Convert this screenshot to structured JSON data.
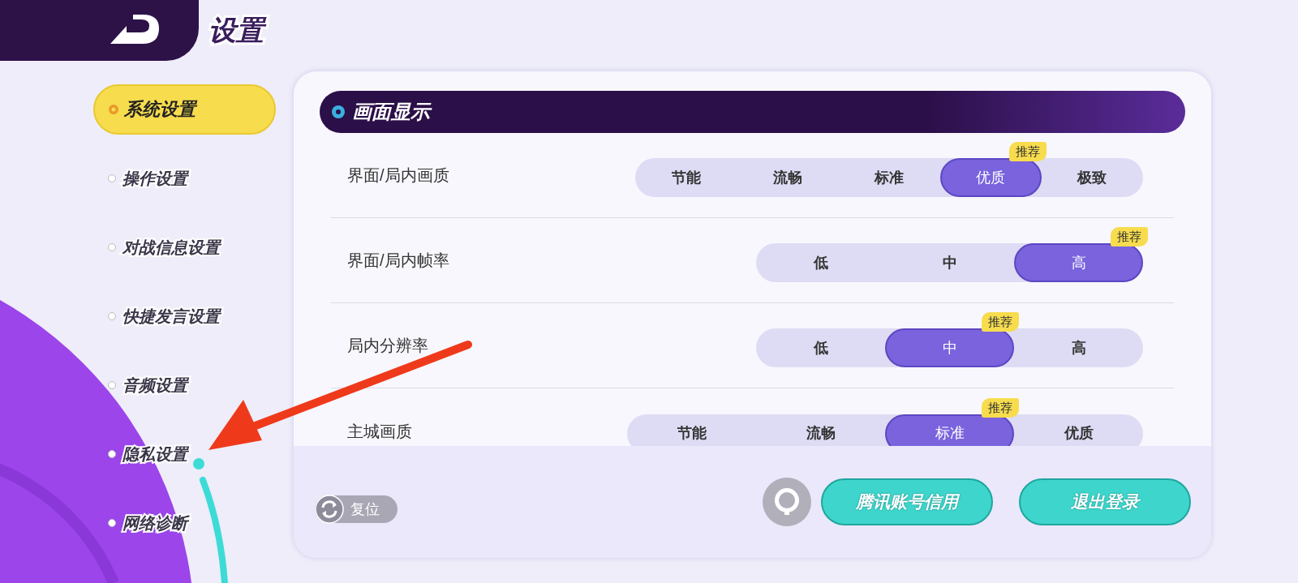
{
  "header": {
    "title": "设置"
  },
  "sidebar": {
    "items": [
      {
        "label": "系统设置",
        "selected": true
      },
      {
        "label": "操作设置",
        "selected": false
      },
      {
        "label": "对战信息设置",
        "selected": false
      },
      {
        "label": "快捷发言设置",
        "selected": false
      },
      {
        "label": "音频设置",
        "selected": false
      },
      {
        "label": "隐私设置",
        "selected": false
      },
      {
        "label": "网络诊断",
        "selected": false
      }
    ]
  },
  "section": {
    "title": "画面显示",
    "rows": [
      {
        "label": "界面/局内画质",
        "options": [
          {
            "label": "节能",
            "selected": false
          },
          {
            "label": "流畅",
            "selected": false
          },
          {
            "label": "标准",
            "selected": false
          },
          {
            "label": "优质",
            "selected": true,
            "badge": "推荐"
          },
          {
            "label": "极致",
            "selected": false
          }
        ]
      },
      {
        "label": "界面/局内帧率",
        "options": [
          {
            "label": "低",
            "selected": false
          },
          {
            "label": "中",
            "selected": false
          },
          {
            "label": "高",
            "selected": true,
            "badge": "推荐"
          }
        ]
      },
      {
        "label": "局内分辨率",
        "options": [
          {
            "label": "低",
            "selected": false
          },
          {
            "label": "中",
            "selected": true,
            "badge": "推荐"
          },
          {
            "label": "高",
            "selected": false
          }
        ]
      },
      {
        "label": "主城画质",
        "options": [
          {
            "label": "节能",
            "selected": false
          },
          {
            "label": "流畅",
            "selected": false
          },
          {
            "label": "标准",
            "selected": true,
            "badge": "推荐"
          },
          {
            "label": "优质",
            "selected": false
          }
        ]
      }
    ]
  },
  "footer": {
    "reset": "复位",
    "buttons": [
      "腾讯账号信用",
      "退出登录"
    ]
  }
}
